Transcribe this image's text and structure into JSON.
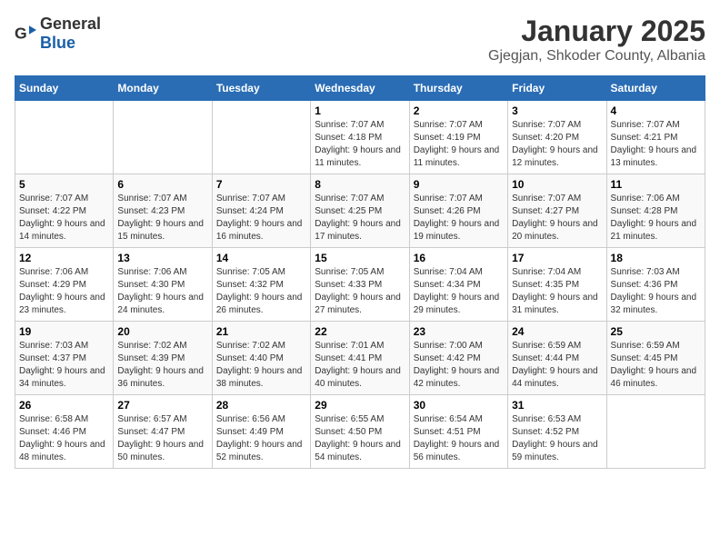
{
  "header": {
    "logo_general": "General",
    "logo_blue": "Blue",
    "month": "January 2025",
    "location": "Gjegjan, Shkoder County, Albania"
  },
  "days_of_week": [
    "Sunday",
    "Monday",
    "Tuesday",
    "Wednesday",
    "Thursday",
    "Friday",
    "Saturday"
  ],
  "weeks": [
    [
      {
        "day": "",
        "sunrise": "",
        "sunset": "",
        "daylight": ""
      },
      {
        "day": "",
        "sunrise": "",
        "sunset": "",
        "daylight": ""
      },
      {
        "day": "",
        "sunrise": "",
        "sunset": "",
        "daylight": ""
      },
      {
        "day": "1",
        "sunrise": "Sunrise: 7:07 AM",
        "sunset": "Sunset: 4:18 PM",
        "daylight": "Daylight: 9 hours and 11 minutes."
      },
      {
        "day": "2",
        "sunrise": "Sunrise: 7:07 AM",
        "sunset": "Sunset: 4:19 PM",
        "daylight": "Daylight: 9 hours and 11 minutes."
      },
      {
        "day": "3",
        "sunrise": "Sunrise: 7:07 AM",
        "sunset": "Sunset: 4:20 PM",
        "daylight": "Daylight: 9 hours and 12 minutes."
      },
      {
        "day": "4",
        "sunrise": "Sunrise: 7:07 AM",
        "sunset": "Sunset: 4:21 PM",
        "daylight": "Daylight: 9 hours and 13 minutes."
      }
    ],
    [
      {
        "day": "5",
        "sunrise": "Sunrise: 7:07 AM",
        "sunset": "Sunset: 4:22 PM",
        "daylight": "Daylight: 9 hours and 14 minutes."
      },
      {
        "day": "6",
        "sunrise": "Sunrise: 7:07 AM",
        "sunset": "Sunset: 4:23 PM",
        "daylight": "Daylight: 9 hours and 15 minutes."
      },
      {
        "day": "7",
        "sunrise": "Sunrise: 7:07 AM",
        "sunset": "Sunset: 4:24 PM",
        "daylight": "Daylight: 9 hours and 16 minutes."
      },
      {
        "day": "8",
        "sunrise": "Sunrise: 7:07 AM",
        "sunset": "Sunset: 4:25 PM",
        "daylight": "Daylight: 9 hours and 17 minutes."
      },
      {
        "day": "9",
        "sunrise": "Sunrise: 7:07 AM",
        "sunset": "Sunset: 4:26 PM",
        "daylight": "Daylight: 9 hours and 19 minutes."
      },
      {
        "day": "10",
        "sunrise": "Sunrise: 7:07 AM",
        "sunset": "Sunset: 4:27 PM",
        "daylight": "Daylight: 9 hours and 20 minutes."
      },
      {
        "day": "11",
        "sunrise": "Sunrise: 7:06 AM",
        "sunset": "Sunset: 4:28 PM",
        "daylight": "Daylight: 9 hours and 21 minutes."
      }
    ],
    [
      {
        "day": "12",
        "sunrise": "Sunrise: 7:06 AM",
        "sunset": "Sunset: 4:29 PM",
        "daylight": "Daylight: 9 hours and 23 minutes."
      },
      {
        "day": "13",
        "sunrise": "Sunrise: 7:06 AM",
        "sunset": "Sunset: 4:30 PM",
        "daylight": "Daylight: 9 hours and 24 minutes."
      },
      {
        "day": "14",
        "sunrise": "Sunrise: 7:05 AM",
        "sunset": "Sunset: 4:32 PM",
        "daylight": "Daylight: 9 hours and 26 minutes."
      },
      {
        "day": "15",
        "sunrise": "Sunrise: 7:05 AM",
        "sunset": "Sunset: 4:33 PM",
        "daylight": "Daylight: 9 hours and 27 minutes."
      },
      {
        "day": "16",
        "sunrise": "Sunrise: 7:04 AM",
        "sunset": "Sunset: 4:34 PM",
        "daylight": "Daylight: 9 hours and 29 minutes."
      },
      {
        "day": "17",
        "sunrise": "Sunrise: 7:04 AM",
        "sunset": "Sunset: 4:35 PM",
        "daylight": "Daylight: 9 hours and 31 minutes."
      },
      {
        "day": "18",
        "sunrise": "Sunrise: 7:03 AM",
        "sunset": "Sunset: 4:36 PM",
        "daylight": "Daylight: 9 hours and 32 minutes."
      }
    ],
    [
      {
        "day": "19",
        "sunrise": "Sunrise: 7:03 AM",
        "sunset": "Sunset: 4:37 PM",
        "daylight": "Daylight: 9 hours and 34 minutes."
      },
      {
        "day": "20",
        "sunrise": "Sunrise: 7:02 AM",
        "sunset": "Sunset: 4:39 PM",
        "daylight": "Daylight: 9 hours and 36 minutes."
      },
      {
        "day": "21",
        "sunrise": "Sunrise: 7:02 AM",
        "sunset": "Sunset: 4:40 PM",
        "daylight": "Daylight: 9 hours and 38 minutes."
      },
      {
        "day": "22",
        "sunrise": "Sunrise: 7:01 AM",
        "sunset": "Sunset: 4:41 PM",
        "daylight": "Daylight: 9 hours and 40 minutes."
      },
      {
        "day": "23",
        "sunrise": "Sunrise: 7:00 AM",
        "sunset": "Sunset: 4:42 PM",
        "daylight": "Daylight: 9 hours and 42 minutes."
      },
      {
        "day": "24",
        "sunrise": "Sunrise: 6:59 AM",
        "sunset": "Sunset: 4:44 PM",
        "daylight": "Daylight: 9 hours and 44 minutes."
      },
      {
        "day": "25",
        "sunrise": "Sunrise: 6:59 AM",
        "sunset": "Sunset: 4:45 PM",
        "daylight": "Daylight: 9 hours and 46 minutes."
      }
    ],
    [
      {
        "day": "26",
        "sunrise": "Sunrise: 6:58 AM",
        "sunset": "Sunset: 4:46 PM",
        "daylight": "Daylight: 9 hours and 48 minutes."
      },
      {
        "day": "27",
        "sunrise": "Sunrise: 6:57 AM",
        "sunset": "Sunset: 4:47 PM",
        "daylight": "Daylight: 9 hours and 50 minutes."
      },
      {
        "day": "28",
        "sunrise": "Sunrise: 6:56 AM",
        "sunset": "Sunset: 4:49 PM",
        "daylight": "Daylight: 9 hours and 52 minutes."
      },
      {
        "day": "29",
        "sunrise": "Sunrise: 6:55 AM",
        "sunset": "Sunset: 4:50 PM",
        "daylight": "Daylight: 9 hours and 54 minutes."
      },
      {
        "day": "30",
        "sunrise": "Sunrise: 6:54 AM",
        "sunset": "Sunset: 4:51 PM",
        "daylight": "Daylight: 9 hours and 56 minutes."
      },
      {
        "day": "31",
        "sunrise": "Sunrise: 6:53 AM",
        "sunset": "Sunset: 4:52 PM",
        "daylight": "Daylight: 9 hours and 59 minutes."
      },
      {
        "day": "",
        "sunrise": "",
        "sunset": "",
        "daylight": ""
      }
    ]
  ]
}
